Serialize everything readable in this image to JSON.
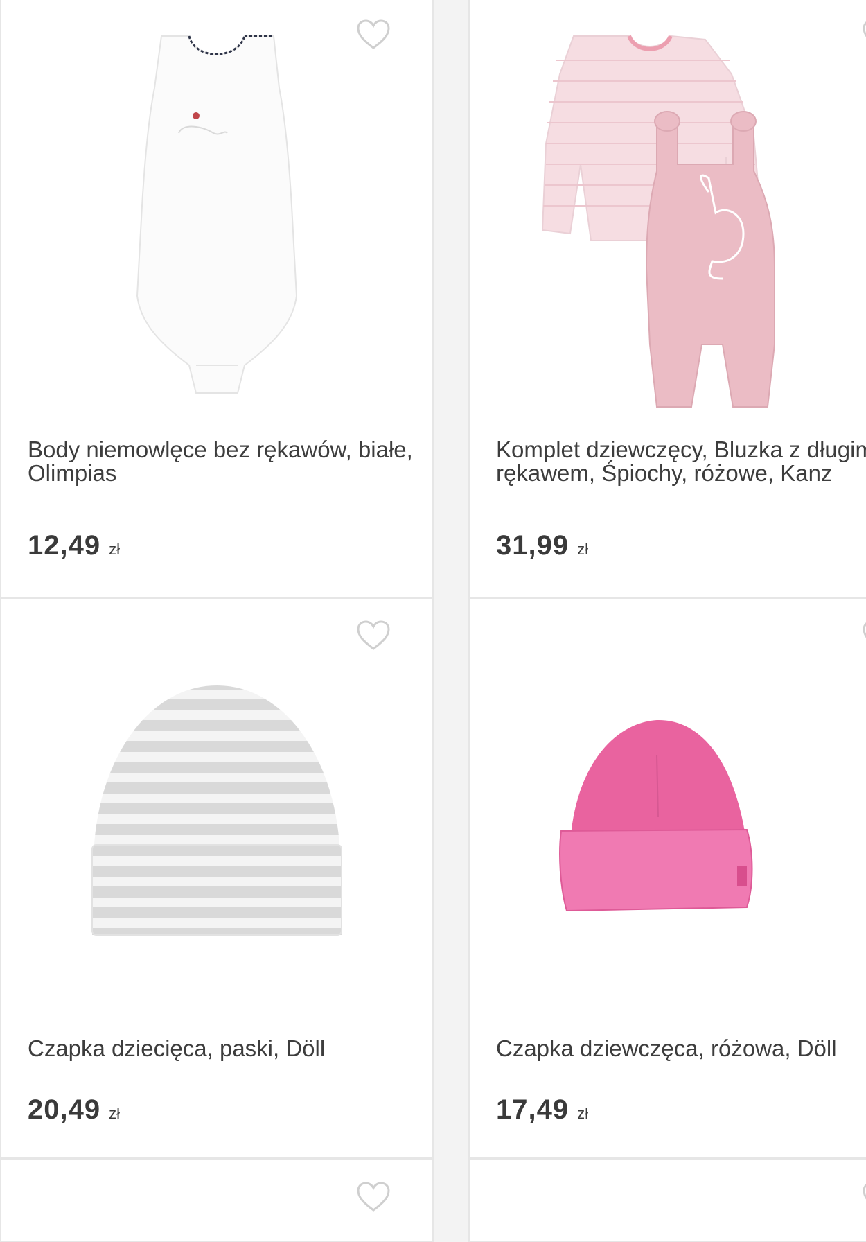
{
  "products": [
    {
      "title": "Body niemowlęce bez rękawów, białe, Olimpias",
      "price": "12,49",
      "currency": "zł",
      "favorite_icon": "heart-outline-icon"
    },
    {
      "title": "Komplet dziewczęcy, Bluzka z długim rękawem, Śpiochy, różowe, Kanz",
      "price": "31,99",
      "currency": "zł",
      "favorite_icon": "heart-outline-icon"
    },
    {
      "title": "Czapka dziecięca, paski, Döll",
      "price": "20,49",
      "currency": "zł",
      "favorite_icon": "heart-outline-icon"
    },
    {
      "title": "Czapka dziewczęca, różowa, Döll",
      "price": "17,49",
      "currency": "zł",
      "favorite_icon": "heart-outline-icon"
    }
  ],
  "colors": {
    "background": "#f3f3f3",
    "card": "#ffffff",
    "text": "#3d3d3d",
    "heart_outline": "#cfcfcf",
    "pink_hat": "#e870a8",
    "pink_set": "#eec3cb"
  }
}
